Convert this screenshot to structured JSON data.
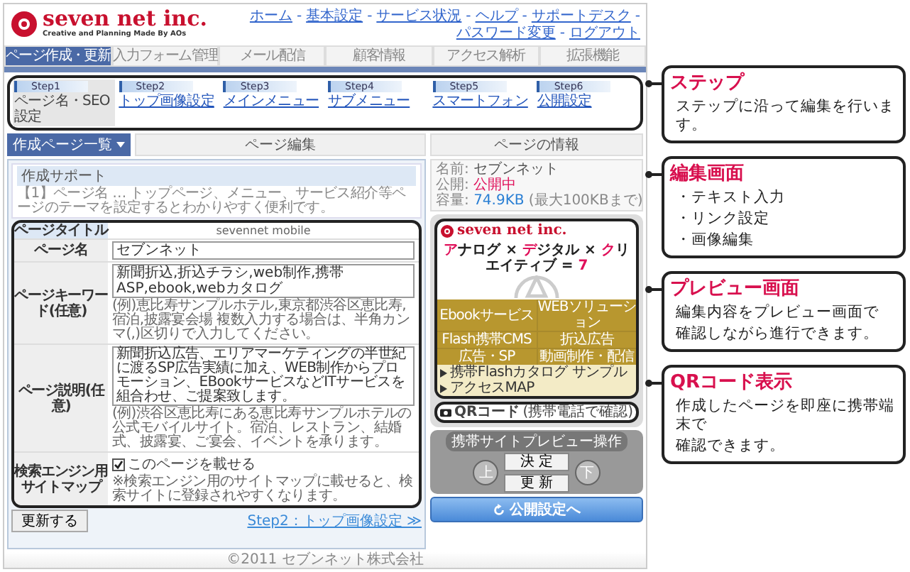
{
  "brand": {
    "name": "seven net inc.",
    "tagline": "Creative and Planning Made By AOs"
  },
  "nav": {
    "separator": "-",
    "links": [
      "ホーム",
      "基本設定",
      "サービス状況",
      "ヘルプ",
      "サポートデスク",
      "パスワード変更",
      "ログアウト"
    ]
  },
  "tabs": [
    {
      "label": "ページ作成・更新",
      "selected": true
    },
    {
      "label": "入力フォーム管理",
      "selected": false
    },
    {
      "label": "メール配信",
      "selected": false
    },
    {
      "label": "顧客情報",
      "selected": false
    },
    {
      "label": "アクセス解析",
      "selected": false
    },
    {
      "label": "拡張機能",
      "selected": false
    }
  ],
  "steps": [
    {
      "step": "Step1",
      "label": "ページ名・SEO設定",
      "selected": true
    },
    {
      "step": "Step2",
      "label": "トップ画像設定",
      "selected": false
    },
    {
      "step": "Step3",
      "label": "メインメニュー",
      "selected": false
    },
    {
      "step": "Step4",
      "label": "サブメニュー",
      "selected": false
    },
    {
      "step": "Step5",
      "label": "スマートフォン",
      "selected": false
    },
    {
      "step": "Step6",
      "label": "公開設定",
      "selected": false
    }
  ],
  "panels": {
    "list_button": "作成ページ一覧",
    "editor_title": "ページ編集",
    "info_title": "ページの情報"
  },
  "support": {
    "title": "作成サポート",
    "text": "【1】ページ名 … トップページ、メニュー、サービス紹介等ページのテーマを設定するとわかりやすく便利です。"
  },
  "form": {
    "header": {
      "label": "ページタイトル",
      "value": "sevennet mobile"
    },
    "rows": [
      {
        "kind": "input",
        "label": "ページ名",
        "value": "セブンネット"
      },
      {
        "kind": "input",
        "label": "ページキーワード(任意)",
        "value": "新聞折込,折込チラシ,web制作,携帯ASP,ebook,webカタログ",
        "note": "(例)恵比寿サンプルホテル,東京都渋谷区恵比寿,宿泊,披露宴会場 複数入力する場合は、半角カンマ(,)区切りで入力してください。"
      },
      {
        "kind": "textarea",
        "label": "ページ説明(任意)",
        "value": "新聞折込広告、エリアマーケティングの半世紀に渡るSP広告実績に加え、WEB制作からプロモーション、EBookサービスなどITサービスを組合わせ、ご提案致します。",
        "note": "(例)渋谷区恵比寿にある恵比寿サンプルホテルの公式モバイルサイト。宿泊、レストラン、結婚式、披露宴、ご宴会、イベントを承ります。"
      },
      {
        "kind": "checkbox",
        "label": "検索エンジン用サイトマップ",
        "value": "このページを載せる",
        "checked": true,
        "note": "※検索エンジン用のサイトマップに載せると、検索サイトに登録されやすくなります。"
      }
    ]
  },
  "actions": {
    "update": "更新する",
    "next": "Step2：トップ画像設定 ≫"
  },
  "info": [
    {
      "label": "名前:",
      "value": "セブンネット",
      "color": "#555555"
    },
    {
      "label": "公開:",
      "value": "公開中",
      "color": "#e0105a"
    },
    {
      "label": "容量:",
      "value": "74.9KB",
      "color": "#2a7fd4",
      "extra": "(最大100KBまで)"
    }
  ],
  "phone": {
    "logo": "seven net inc.",
    "slogan": [
      {
        "text": "ア",
        "accent": true
      },
      {
        "text": "ナログ × ",
        "accent": false
      },
      {
        "text": "デ",
        "accent": true
      },
      {
        "text": "ジタル × ",
        "accent": false
      },
      {
        "text": "ク",
        "accent": true
      },
      {
        "text": "リエイティブ = ",
        "accent": false
      },
      {
        "text": "7",
        "accent": true
      }
    ],
    "menu": [
      "Ebookサービス",
      "WEBソリューション",
      "Flash携帯CMS",
      "折込広告",
      "広告・SP",
      "動画制作・配信"
    ],
    "links": [
      "携帯Flashカタログ サンプル",
      "アクセスMAP"
    ]
  },
  "qr": {
    "label": "QRコード",
    "hint": "(携帯電話で確認)"
  },
  "operations": {
    "title": "携帯サイトプレビュー操作",
    "up": "上",
    "confirm": "決 定",
    "refresh": "更 新",
    "down": "下"
  },
  "publish": "公開設定へ",
  "footer": "©2011 セブンネット株式会社",
  "callouts": [
    {
      "title": "ステップ",
      "lines": [
        "ステップに沿って編集を行います。"
      ]
    },
    {
      "title": "編集画面",
      "lines": [
        "・テキスト入力",
        "・リンク設定",
        "・画像編集"
      ]
    },
    {
      "title": "プレビュー画面",
      "lines": [
        "編集内容をプレビュー画面で",
        "確認しながら進行できます。"
      ]
    },
    {
      "title": "QRコード表示",
      "lines": [
        "作成したページを即座に携帯端末で",
        "確認できます。"
      ]
    }
  ]
}
